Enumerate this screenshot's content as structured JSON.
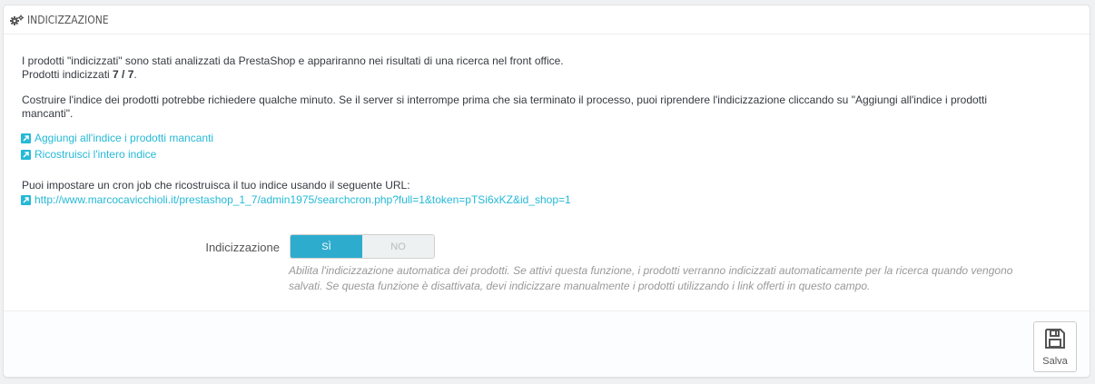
{
  "panel": {
    "icon": "gears-icon",
    "title": "INDICIZZAZIONE"
  },
  "intro": {
    "line1": "I prodotti \"indicizzati\" sono stati analizzati da PrestaShop e appariranno nei risultati di una ricerca nel front office.",
    "line2_prefix": "Prodotti indicizzati ",
    "line2_count": "7 / 7",
    "line2_suffix": "."
  },
  "info": {
    "line1": "Costruire l'indice dei prodotti potrebbe richiedere qualche minuto. Se il server si interrompe prima che sia terminato il processo, puoi riprendere l'indicizzazione cliccando su \"Aggiungi all'indice i prodotti",
    "line2": "mancanti\"."
  },
  "links": {
    "add_missing": "Aggiungi all'indice i prodotti mancanti",
    "rebuild": "Ricostruisci l'intero indice",
    "icon": "external-link-icon"
  },
  "cron": {
    "text": "Puoi impostare un cron job che ricostruisca il tuo indice usando il seguente URL:",
    "url": "http://www.marcocavicchioli.it/prestashop_1_7/admin1975/searchcron.php?full=1&token=pTSi6xKZ&id_shop=1"
  },
  "form": {
    "label": "Indicizzazione",
    "yes": "SÌ",
    "no": "NO",
    "value": "SÌ",
    "help_line1": "Abilita l'indicizzazione automatica dei prodotti. Se attivi questa funzione, i prodotti verranno indicizzati automaticamente per la ricerca quando vengono",
    "help_line2": "salvati. Se questa funzione è disattivata, devi indicizzare manualmente i prodotti utilizzando i link offerti in questo campo."
  },
  "footer": {
    "save_label": "Salva",
    "save_icon": "floppy-disk-icon"
  },
  "colors": {
    "accent": "#2eacce",
    "link": "#25b9d7"
  }
}
